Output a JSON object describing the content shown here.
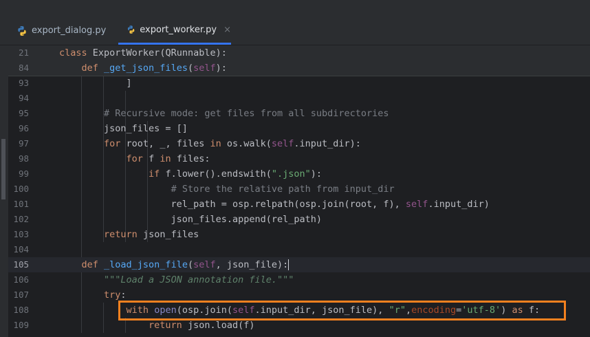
{
  "tabs": [
    {
      "label": "export_dialog.py",
      "active": false,
      "icon": "python-icon"
    },
    {
      "label": "export_worker.py",
      "active": true,
      "icon": "python-icon",
      "close": "×"
    }
  ],
  "sticky": [
    {
      "num": "21",
      "parts": [
        [
          "kw",
          "class "
        ],
        [
          "",
          "ExportWorker(QRunnable):"
        ]
      ]
    },
    {
      "num": "84",
      "parts": [
        [
          "",
          "    "
        ],
        [
          "kw",
          "def "
        ],
        [
          "fn",
          "_get_json_files"
        ],
        [
          "",
          "("
        ],
        [
          "self",
          "self"
        ],
        [
          "",
          "):"
        ]
      ]
    }
  ],
  "lines": [
    {
      "num": "93",
      "parts": [
        [
          "",
          "            ]"
        ]
      ]
    },
    {
      "num": "94",
      "parts": []
    },
    {
      "num": "95",
      "parts": [
        [
          "",
          "        "
        ],
        [
          "cm",
          "# Recursive mode: get files from all subdirectories"
        ]
      ]
    },
    {
      "num": "96",
      "parts": [
        [
          "",
          "        json_files = []"
        ]
      ]
    },
    {
      "num": "97",
      "parts": [
        [
          "",
          "        "
        ],
        [
          "kw",
          "for "
        ],
        [
          "",
          "root, _, files "
        ],
        [
          "kw",
          "in "
        ],
        [
          "",
          "os.walk("
        ],
        [
          "self",
          "self"
        ],
        [
          "",
          ".input_dir):"
        ]
      ]
    },
    {
      "num": "98",
      "parts": [
        [
          "",
          "            "
        ],
        [
          "kw",
          "for "
        ],
        [
          "",
          "f "
        ],
        [
          "kw",
          "in "
        ],
        [
          "",
          "files:"
        ]
      ]
    },
    {
      "num": "99",
      "parts": [
        [
          "",
          "                "
        ],
        [
          "kw",
          "if "
        ],
        [
          "",
          "f.lower().endswith("
        ],
        [
          "str",
          "\".json\""
        ],
        [
          "",
          "):"
        ]
      ]
    },
    {
      "num": "100",
      "parts": [
        [
          "",
          "                    "
        ],
        [
          "cm",
          "# Store the relative path from input_dir"
        ]
      ]
    },
    {
      "num": "101",
      "parts": [
        [
          "",
          "                    rel_path = osp.relpath(osp.join(root, f), "
        ],
        [
          "self",
          "self"
        ],
        [
          "",
          ".input_dir)"
        ]
      ]
    },
    {
      "num": "102",
      "parts": [
        [
          "",
          "                    json_files.append(rel_path)"
        ]
      ]
    },
    {
      "num": "103",
      "parts": [
        [
          "",
          "        "
        ],
        [
          "kw",
          "return "
        ],
        [
          "",
          "json_files"
        ]
      ]
    },
    {
      "num": "104",
      "parts": []
    },
    {
      "num": "105",
      "current": true,
      "parts": [
        [
          "",
          "    "
        ],
        [
          "kw",
          "def "
        ],
        [
          "fn",
          "_load_json_file"
        ],
        [
          "",
          "("
        ],
        [
          "self",
          "self"
        ],
        [
          "",
          ", json_file):"
        ]
      ]
    },
    {
      "num": "106",
      "parts": [
        [
          "",
          "        "
        ],
        [
          "doc",
          "\"\"\"Load a JSON annotation file.\"\"\""
        ]
      ]
    },
    {
      "num": "107",
      "parts": [
        [
          "",
          "        "
        ],
        [
          "kw",
          "try"
        ],
        [
          "",
          ":"
        ]
      ]
    },
    {
      "num": "108",
      "parts": [
        [
          "",
          "            "
        ],
        [
          "kw",
          "with "
        ],
        [
          "bi",
          "open"
        ],
        [
          "",
          "(osp.join("
        ],
        [
          "self",
          "self"
        ],
        [
          "",
          ".input_dir, json_file), "
        ],
        [
          "str",
          "\"r\""
        ],
        [
          "",
          ","
        ],
        [
          "kwarg",
          "encoding"
        ],
        [
          "",
          "="
        ],
        [
          "str",
          "'utf-8'"
        ],
        [
          "",
          ") "
        ],
        [
          "kw",
          "as "
        ],
        [
          "",
          "f:"
        ]
      ]
    },
    {
      "num": "109",
      "parts": [
        [
          "",
          "                "
        ],
        [
          "kw",
          "return "
        ],
        [
          "",
          "json.load(f)"
        ]
      ]
    }
  ]
}
